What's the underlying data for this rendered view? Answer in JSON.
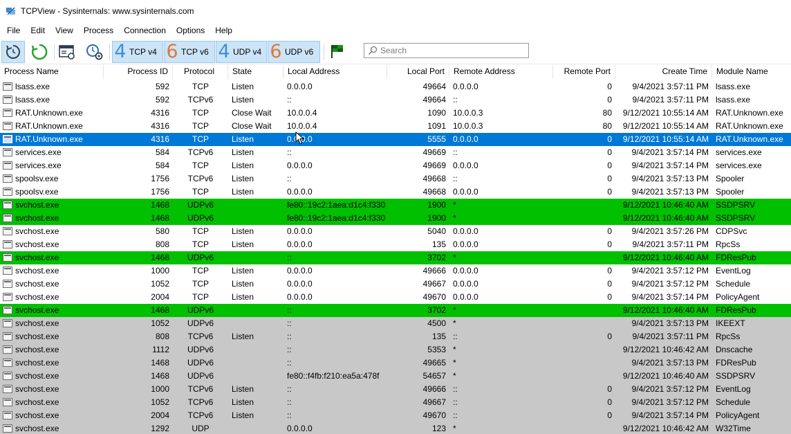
{
  "window": {
    "title": "TCPView - Sysinternals: www.sysinternals.com"
  },
  "menu": [
    "File",
    "Edit",
    "View",
    "Process",
    "Connection",
    "Options",
    "Help"
  ],
  "toolbar": {
    "refresh_icon": "refresh-icon",
    "tcp4": {
      "num": "4",
      "label": "TCP v4"
    },
    "tcp6": {
      "num": "6",
      "label": "TCP v6"
    },
    "udp4": {
      "num": "4",
      "label": "UDP v4"
    },
    "udp6": {
      "num": "6",
      "label": "UDP v6"
    },
    "search_placeholder": "Search"
  },
  "colors": {
    "accent_blue": "#3d8fd6",
    "accent_orange": "#e0773a",
    "new_connection_green": "#00c000",
    "closed_connection_gray": "#c8c8c8",
    "selection_blue": "#0078d7"
  },
  "columns": [
    "Process Name",
    "Process ID",
    "Protocol",
    "State",
    "Local Address",
    "Local Port",
    "Remote Address",
    "Remote Port",
    "Create Time",
    "Module Name"
  ],
  "rows": [
    {
      "process": "lsass.exe",
      "pid": "592",
      "protocol": "TCP",
      "state": "Listen",
      "local_address": "0.0.0.0",
      "local_port": "49664",
      "remote_address": "0.0.0.0",
      "remote_port": "0",
      "create_time": "9/4/2021 3:57:11 PM",
      "module": "lsass.exe",
      "status": "white"
    },
    {
      "process": "lsass.exe",
      "pid": "592",
      "protocol": "TCPv6",
      "state": "Listen",
      "local_address": "::",
      "local_port": "49664",
      "remote_address": "::",
      "remote_port": "0",
      "create_time": "9/4/2021 3:57:11 PM",
      "module": "lsass.exe",
      "status": "white"
    },
    {
      "process": "RAT.Unknown.exe",
      "pid": "4316",
      "protocol": "TCP",
      "state": "Close Wait",
      "local_address": "10.0.0.4",
      "local_port": "1090",
      "remote_address": "10.0.0.3",
      "remote_port": "80",
      "create_time": "9/12/2021 10:55:14 AM",
      "module": "RAT.Unknown.exe",
      "status": "white"
    },
    {
      "process": "RAT.Unknown.exe",
      "pid": "4316",
      "protocol": "TCP",
      "state": "Close Wait",
      "local_address": "10.0.0.4",
      "local_port": "1091",
      "remote_address": "10.0.0.3",
      "remote_port": "80",
      "create_time": "9/12/2021 10:55:14 AM",
      "module": "RAT.Unknown.exe",
      "status": "white"
    },
    {
      "process": "RAT.Unknown.exe",
      "pid": "4316",
      "protocol": "TCP",
      "state": "Listen",
      "local_address": "0.0.0.0",
      "local_port": "5555",
      "remote_address": "0.0.0.0",
      "remote_port": "0",
      "create_time": "9/12/2021 10:55:14 AM",
      "module": "RAT.Unknown.exe",
      "status": "selected"
    },
    {
      "process": "services.exe",
      "pid": "584",
      "protocol": "TCPv6",
      "state": "Listen",
      "local_address": "::",
      "local_port": "49669",
      "remote_address": "::",
      "remote_port": "0",
      "create_time": "9/4/2021 3:57:14 PM",
      "module": "services.exe",
      "status": "white"
    },
    {
      "process": "services.exe",
      "pid": "584",
      "protocol": "TCP",
      "state": "Listen",
      "local_address": "0.0.0.0",
      "local_port": "49669",
      "remote_address": "0.0.0.0",
      "remote_port": "0",
      "create_time": "9/4/2021 3:57:14 PM",
      "module": "services.exe",
      "status": "white"
    },
    {
      "process": "spoolsv.exe",
      "pid": "1756",
      "protocol": "TCPv6",
      "state": "Listen",
      "local_address": "::",
      "local_port": "49668",
      "remote_address": "::",
      "remote_port": "0",
      "create_time": "9/4/2021 3:57:13 PM",
      "module": "Spooler",
      "status": "white"
    },
    {
      "process": "spoolsv.exe",
      "pid": "1756",
      "protocol": "TCP",
      "state": "Listen",
      "local_address": "0.0.0.0",
      "local_port": "49668",
      "remote_address": "0.0.0.0",
      "remote_port": "0",
      "create_time": "9/4/2021 3:57:13 PM",
      "module": "Spooler",
      "status": "white"
    },
    {
      "process": "svchost.exe",
      "pid": "1468",
      "protocol": "UDPv6",
      "state": "",
      "local_address": "fe80::19c2:1aea:d1c4:f330",
      "local_port": "1900",
      "remote_address": "*",
      "remote_port": "",
      "create_time": "9/12/2021 10:46:40 AM",
      "module": "SSDPSRV",
      "status": "green"
    },
    {
      "process": "svchost.exe",
      "pid": "1468",
      "protocol": "UDPv6",
      "state": "",
      "local_address": "fe80::19c2:1aea:d1c4:f330",
      "local_port": "1900",
      "remote_address": "*",
      "remote_port": "",
      "create_time": "9/12/2021 10:46:40 AM",
      "module": "SSDPSRV",
      "status": "green"
    },
    {
      "process": "svchost.exe",
      "pid": "580",
      "protocol": "TCP",
      "state": "Listen",
      "local_address": "0.0.0.0",
      "local_port": "5040",
      "remote_address": "0.0.0.0",
      "remote_port": "0",
      "create_time": "9/4/2021 3:57:26 PM",
      "module": "CDPSvc",
      "status": "white"
    },
    {
      "process": "svchost.exe",
      "pid": "808",
      "protocol": "TCP",
      "state": "Listen",
      "local_address": "0.0.0.0",
      "local_port": "135",
      "remote_address": "0.0.0.0",
      "remote_port": "0",
      "create_time": "9/4/2021 3:57:11 PM",
      "module": "RpcSs",
      "status": "white"
    },
    {
      "process": "svchost.exe",
      "pid": "1468",
      "protocol": "UDPv6",
      "state": "",
      "local_address": "::",
      "local_port": "3702",
      "remote_address": "*",
      "remote_port": "",
      "create_time": "9/12/2021 10:46:40 AM",
      "module": "FDResPub",
      "status": "green"
    },
    {
      "process": "svchost.exe",
      "pid": "1000",
      "protocol": "TCP",
      "state": "Listen",
      "local_address": "0.0.0.0",
      "local_port": "49666",
      "remote_address": "0.0.0.0",
      "remote_port": "0",
      "create_time": "9/4/2021 3:57:12 PM",
      "module": "EventLog",
      "status": "white"
    },
    {
      "process": "svchost.exe",
      "pid": "1052",
      "protocol": "TCP",
      "state": "Listen",
      "local_address": "0.0.0.0",
      "local_port": "49667",
      "remote_address": "0.0.0.0",
      "remote_port": "0",
      "create_time": "9/4/2021 3:57:12 PM",
      "module": "Schedule",
      "status": "white"
    },
    {
      "process": "svchost.exe",
      "pid": "2004",
      "protocol": "TCP",
      "state": "Listen",
      "local_address": "0.0.0.0",
      "local_port": "49670",
      "remote_address": "0.0.0.0",
      "remote_port": "0",
      "create_time": "9/4/2021 3:57:14 PM",
      "module": "PolicyAgent",
      "status": "white"
    },
    {
      "process": "svchost.exe",
      "pid": "1468",
      "protocol": "UDPv6",
      "state": "",
      "local_address": "::",
      "local_port": "3702",
      "remote_address": "*",
      "remote_port": "",
      "create_time": "9/12/2021 10:46:40 AM",
      "module": "FDResPub",
      "status": "green"
    },
    {
      "process": "svchost.exe",
      "pid": "1052",
      "protocol": "UDPv6",
      "state": "",
      "local_address": "::",
      "local_port": "4500",
      "remote_address": "*",
      "remote_port": "",
      "create_time": "9/4/2021 3:57:13 PM",
      "module": "IKEEXT",
      "status": "gray"
    },
    {
      "process": "svchost.exe",
      "pid": "808",
      "protocol": "TCPv6",
      "state": "Listen",
      "local_address": "::",
      "local_port": "135",
      "remote_address": "::",
      "remote_port": "0",
      "create_time": "9/4/2021 3:57:11 PM",
      "module": "RpcSs",
      "status": "gray"
    },
    {
      "process": "svchost.exe",
      "pid": "1112",
      "protocol": "UDPv6",
      "state": "",
      "local_address": "::",
      "local_port": "5353",
      "remote_address": "*",
      "remote_port": "",
      "create_time": "9/12/2021 10:46:42 AM",
      "module": "Dnscache",
      "status": "gray"
    },
    {
      "process": "svchost.exe",
      "pid": "1468",
      "protocol": "UDPv6",
      "state": "",
      "local_address": "::",
      "local_port": "49665",
      "remote_address": "*",
      "remote_port": "",
      "create_time": "9/4/2021 3:57:13 PM",
      "module": "FDResPub",
      "status": "gray"
    },
    {
      "process": "svchost.exe",
      "pid": "1468",
      "protocol": "UDPv6",
      "state": "",
      "local_address": "fe80::f4fb:f210:ea5a:478f",
      "local_port": "54657",
      "remote_address": "*",
      "remote_port": "",
      "create_time": "9/12/2021 10:46:40 AM",
      "module": "SSDPSRV",
      "status": "gray"
    },
    {
      "process": "svchost.exe",
      "pid": "1000",
      "protocol": "TCPv6",
      "state": "Listen",
      "local_address": "::",
      "local_port": "49666",
      "remote_address": "::",
      "remote_port": "0",
      "create_time": "9/4/2021 3:57:12 PM",
      "module": "EventLog",
      "status": "gray"
    },
    {
      "process": "svchost.exe",
      "pid": "1052",
      "protocol": "TCPv6",
      "state": "Listen",
      "local_address": "::",
      "local_port": "49667",
      "remote_address": "::",
      "remote_port": "0",
      "create_time": "9/4/2021 3:57:12 PM",
      "module": "Schedule",
      "status": "gray"
    },
    {
      "process": "svchost.exe",
      "pid": "2004",
      "protocol": "TCPv6",
      "state": "Listen",
      "local_address": "::",
      "local_port": "49670",
      "remote_address": "::",
      "remote_port": "0",
      "create_time": "9/4/2021 3:57:14 PM",
      "module": "PolicyAgent",
      "status": "gray"
    },
    {
      "process": "svchost.exe",
      "pid": "1292",
      "protocol": "UDP",
      "state": "",
      "local_address": "0.0.0.0",
      "local_port": "123",
      "remote_address": "*",
      "remote_port": "",
      "create_time": "9/12/2021 10:46:42 AM",
      "module": "W32Time",
      "status": "gray"
    }
  ]
}
